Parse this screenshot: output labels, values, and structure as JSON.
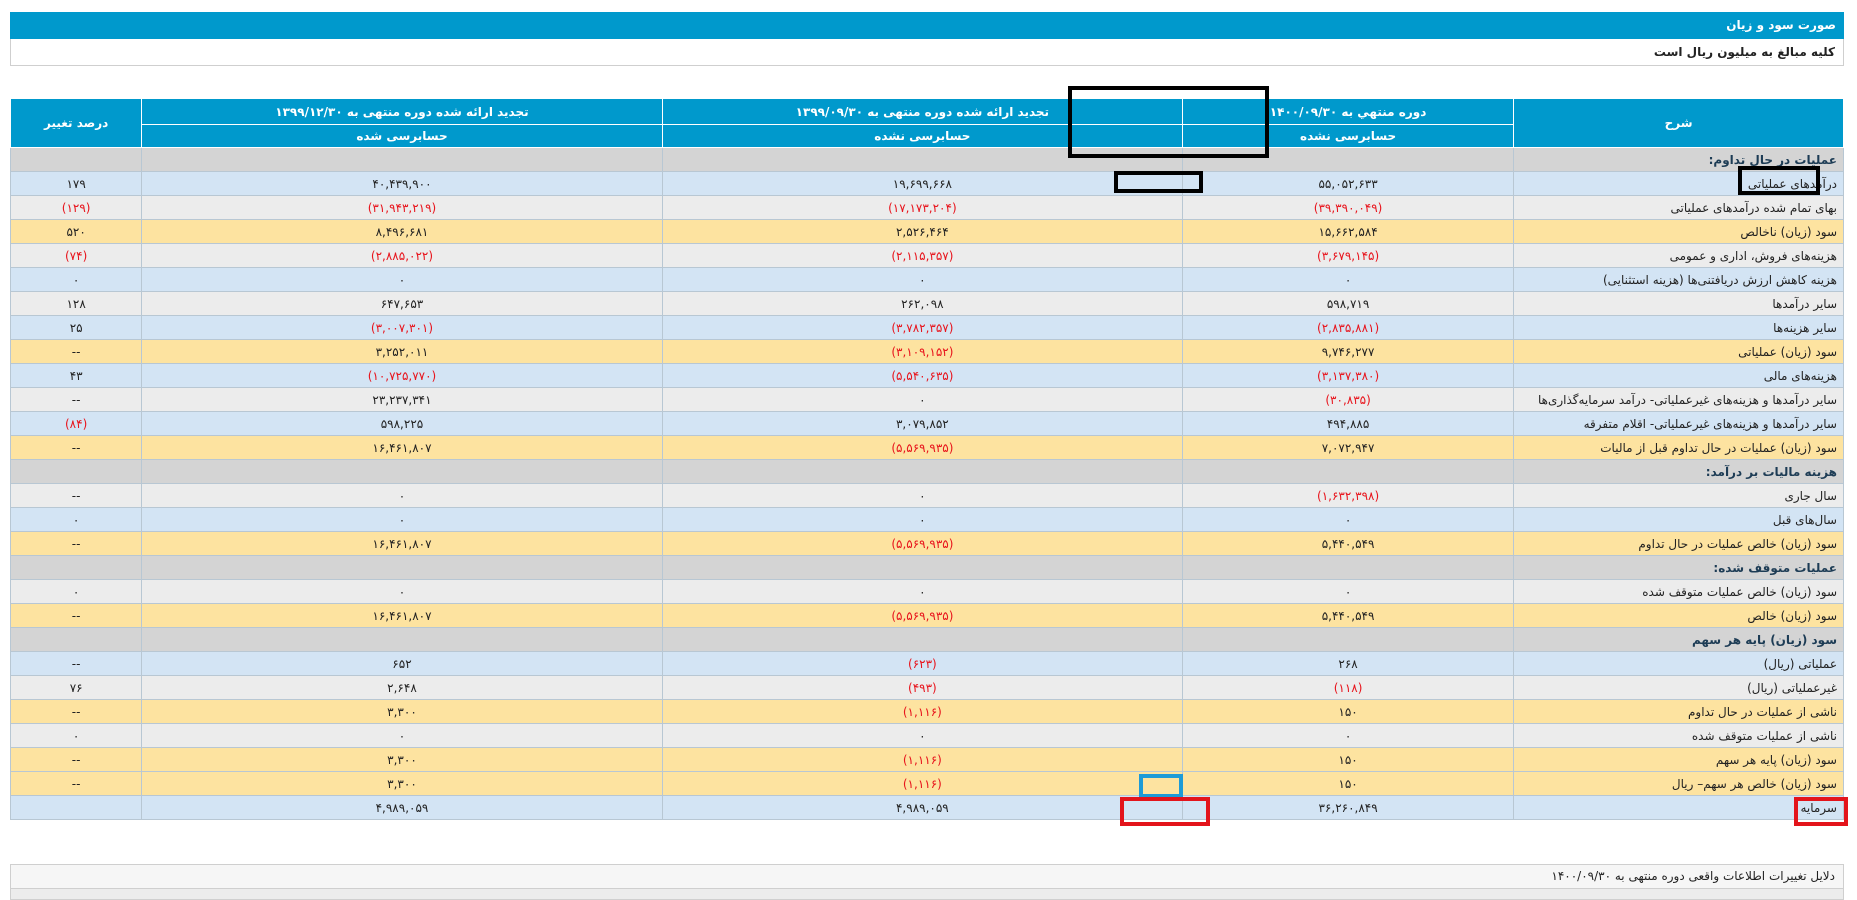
{
  "header": {
    "title": "صورت سود و زیان",
    "subtitle": "کلیه مبالغ به میلیون ریال است"
  },
  "columns": {
    "desc": "شرح",
    "c1": "دوره منتهي به ۱۴۰۰/۰۹/۳۰",
    "c1_status": "حسابرسی نشده",
    "c2": "تجدید ارائه شده دوره منتهی به ۱۳۹۹/۰۹/۳۰",
    "c2_status": "حسابرسی نشده",
    "c3": "تجدید ارائه شده دوره منتهی به ۱۳۹۹/۱۲/۳۰",
    "c3_status": "حسابرسی شده",
    "pct": "درصد تغییر"
  },
  "rows": [
    {
      "type": "section",
      "desc": "عملیات در حال تداوم:"
    },
    {
      "type": "blue",
      "desc": "درآمدهای عملیاتی",
      "c1": "۵۵,۰۵۲,۶۳۳",
      "c2": "۱۹,۶۹۹,۶۶۸",
      "c3": "۴۰,۴۳۹,۹۰۰",
      "pct": "۱۷۹"
    },
    {
      "type": "gray",
      "desc": "بهای تمام شده درآمدهای عملیاتی",
      "c1": "(۳۹,۳۹۰,۰۴۹)",
      "c2": "(۱۷,۱۷۳,۲۰۴)",
      "c3": "(۳۱,۹۴۳,۲۱۹)",
      "pct": "(۱۲۹)"
    },
    {
      "type": "yellow",
      "desc": "سود (زیان) ناخالص",
      "c1": "۱۵,۶۶۲,۵۸۴",
      "c2": "۲,۵۲۶,۴۶۴",
      "c3": "۸,۴۹۶,۶۸۱",
      "pct": "۵۲۰"
    },
    {
      "type": "gray",
      "desc": "هزینه‌های فروش، اداری و عمومی",
      "c1": "(۳,۶۷۹,۱۴۵)",
      "c2": "(۲,۱۱۵,۳۵۷)",
      "c3": "(۲,۸۸۵,۰۲۲)",
      "pct": "(۷۴)"
    },
    {
      "type": "blue",
      "desc": "هزینه کاهش ارزش دریافتنی‌ها (هزینه استثنایی)",
      "c1": "۰",
      "c2": "۰",
      "c3": "۰",
      "pct": "۰"
    },
    {
      "type": "gray",
      "desc": "سایر درآمدها",
      "c1": "۵۹۸,۷۱۹",
      "c2": "۲۶۲,۰۹۸",
      "c3": "۶۴۷,۶۵۳",
      "pct": "۱۲۸"
    },
    {
      "type": "blue",
      "desc": "سایر هزینه‌ها",
      "c1": "(۲,۸۳۵,۸۸۱)",
      "c2": "(۳,۷۸۲,۳۵۷)",
      "c3": "(۳,۰۰۷,۳۰۱)",
      "pct": "۲۵"
    },
    {
      "type": "yellow",
      "desc": "سود (زیان) عملیاتی",
      "c1": "۹,۷۴۶,۲۷۷",
      "c2": "(۳,۱۰۹,۱۵۲)",
      "c3": "۳,۲۵۲,۰۱۱",
      "pct": "--"
    },
    {
      "type": "blue",
      "desc": "هزینه‌های مالی",
      "c1": "(۳,۱۳۷,۳۸۰)",
      "c2": "(۵,۵۴۰,۶۳۵)",
      "c3": "(۱۰,۷۲۵,۷۷۰)",
      "pct": "۴۳"
    },
    {
      "type": "gray",
      "desc": "سایر درآمدها و هزینه‌های غیرعملیاتی- درآمد سرمایه‌گذاری‌ها",
      "c1": "(۳۰,۸۳۵)",
      "c2": "۰",
      "c3": "۲۳,۲۳۷,۳۴۱",
      "pct": "--"
    },
    {
      "type": "blue",
      "desc": "سایر درآمدها و هزینه‌های غیرعملیاتی- اقلام متفرقه",
      "c1": "۴۹۴,۸۸۵",
      "c2": "۳,۰۷۹,۸۵۲",
      "c3": "۵۹۸,۲۲۵",
      "pct": "(۸۴)"
    },
    {
      "type": "yellow",
      "desc": "سود (زیان) عملیات در حال تداوم قبل از مالیات",
      "c1": "۷,۰۷۲,۹۴۷",
      "c2": "(۵,۵۶۹,۹۳۵)",
      "c3": "۱۶,۴۶۱,۸۰۷",
      "pct": "--"
    },
    {
      "type": "section",
      "desc": "هزینه مالیات بر درآمد:"
    },
    {
      "type": "gray",
      "desc": "سال جاری",
      "c1": "(۱,۶۳۲,۳۹۸)",
      "c2": "۰",
      "c3": "۰",
      "pct": "--"
    },
    {
      "type": "blue",
      "desc": "سال‌های قبل",
      "c1": "۰",
      "c2": "۰",
      "c3": "۰",
      "pct": "۰"
    },
    {
      "type": "yellow",
      "desc": "سود (زیان) خالص عملیات در حال تداوم",
      "c1": "۵,۴۴۰,۵۴۹",
      "c2": "(۵,۵۶۹,۹۳۵)",
      "c3": "۱۶,۴۶۱,۸۰۷",
      "pct": "--"
    },
    {
      "type": "section",
      "desc": "عملیات متوقف شده:"
    },
    {
      "type": "gray",
      "desc": "سود (زیان) خالص عملیات متوقف شده",
      "c1": "۰",
      "c2": "۰",
      "c3": "۰",
      "pct": "۰"
    },
    {
      "type": "yellow",
      "desc": "سود (زیان) خالص",
      "c1": "۵,۴۴۰,۵۴۹",
      "c2": "(۵,۵۶۹,۹۳۵)",
      "c3": "۱۶,۴۶۱,۸۰۷",
      "pct": "--"
    },
    {
      "type": "section",
      "desc": "سود (زیان) پایه هر سهم"
    },
    {
      "type": "blue",
      "desc": "عملیاتی (ریال)",
      "c1": "۲۶۸",
      "c2": "(۶۲۳)",
      "c3": "۶۵۲",
      "pct": "--"
    },
    {
      "type": "gray",
      "desc": "غیرعملیاتی (ریال)",
      "c1": "(۱۱۸)",
      "c2": "(۴۹۳)",
      "c3": "۲,۶۴۸",
      "pct": "۷۶"
    },
    {
      "type": "yellow",
      "desc": "ناشی از عملیات در حال تداوم",
      "c1": "۱۵۰",
      "c2": "(۱,۱۱۶)",
      "c3": "۳,۳۰۰",
      "pct": "--"
    },
    {
      "type": "gray",
      "desc": "ناشی از عملیات متوقف شده",
      "c1": "۰",
      "c2": "۰",
      "c3": "۰",
      "pct": "۰"
    },
    {
      "type": "yellow",
      "desc": "سود (زیان) پایه هر سهم",
      "c1": "۱۵۰",
      "c2": "(۱,۱۱۶)",
      "c3": "۳,۳۰۰",
      "pct": "--"
    },
    {
      "type": "yellow",
      "desc": "سود (زیان) خالص هر سهم– ریال",
      "c1": "۱۵۰",
      "c2": "(۱,۱۱۶)",
      "c3": "۳,۳۰۰",
      "pct": "--"
    },
    {
      "type": "blue",
      "desc": "سرمایه",
      "c1": "۳۶,۲۶۰,۸۴۹",
      "c2": "۴,۹۸۹,۰۵۹",
      "c3": "۴,۹۸۹,۰۵۹",
      "pct": ""
    }
  ],
  "footer": {
    "note": "دلایل تغییرات اطلاعات واقعی دوره منتهی به ۱۴۰۰/۰۹/۳۰"
  }
}
